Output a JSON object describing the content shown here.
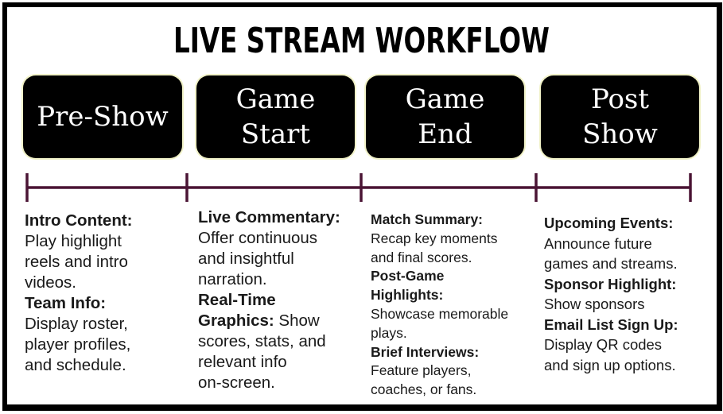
{
  "title": "LIVE STREAM WORKFLOW",
  "colors": {
    "timeline": "#4a1434",
    "box_bg": "#000000",
    "box_text": "#ffffff",
    "box_glow": "#f1f2c8"
  },
  "phases": [
    {
      "lines": [
        "Pre-Show"
      ]
    },
    {
      "lines": [
        "Game",
        "Start"
      ]
    },
    {
      "lines": [
        "Game",
        "End"
      ]
    },
    {
      "lines": [
        "Post",
        "Show"
      ]
    }
  ],
  "columns": [
    {
      "lines": [
        {
          "bold": "Intro Content:",
          "text": ""
        },
        {
          "bold": "",
          "text": "Play highlight"
        },
        {
          "bold": "",
          "text": "reels and intro"
        },
        {
          "bold": "",
          "text": "videos."
        },
        {
          "bold": "Team Info:",
          "text": ""
        },
        {
          "bold": "",
          "text": "Display roster,"
        },
        {
          "bold": "",
          "text": "player profiles,"
        },
        {
          "bold": "",
          "text": "and schedule."
        }
      ]
    },
    {
      "lines": [
        {
          "bold": "Live Commentary:",
          "text": ""
        },
        {
          "bold": "",
          "text": "Offer continuous"
        },
        {
          "bold": "",
          "text": "and insightful"
        },
        {
          "bold": "",
          "text": "narration."
        },
        {
          "bold": "Real-Time",
          "text": ""
        },
        {
          "bold": "Graphics:",
          "text": " Show"
        },
        {
          "bold": "",
          "text": "scores, stats, and"
        },
        {
          "bold": "",
          "text": "relevant info"
        },
        {
          "bold": "",
          "text": "on-screen."
        }
      ]
    },
    {
      "lines": [
        {
          "bold": "Match Summary:",
          "text": ""
        },
        {
          "bold": "",
          "text": "Recap key moments"
        },
        {
          "bold": "",
          "text": "and final scores."
        },
        {
          "bold": "Post-Game",
          "text": ""
        },
        {
          "bold": "Highlights:",
          "text": ""
        },
        {
          "bold": "",
          "text": "Showcase memorable"
        },
        {
          "bold": "",
          "text": "plays."
        },
        {
          "bold": "Brief Interviews:",
          "text": ""
        },
        {
          "bold": "",
          "text": "Feature players,"
        },
        {
          "bold": "",
          "text": "coaches, or fans."
        }
      ]
    },
    {
      "lines": [
        {
          "bold": "Upcoming Events:",
          "text": ""
        },
        {
          "bold": "",
          "text": "Announce future"
        },
        {
          "bold": "",
          "text": "games and streams."
        },
        {
          "bold": "Sponsor Highlight:",
          "text": ""
        },
        {
          "bold": "",
          "text": "Show sponsors"
        },
        {
          "bold": "Email List Sign Up:",
          "text": ""
        },
        {
          "bold": "",
          "text": "Display QR codes"
        },
        {
          "bold": "",
          "text": "and sign up options."
        }
      ]
    }
  ]
}
